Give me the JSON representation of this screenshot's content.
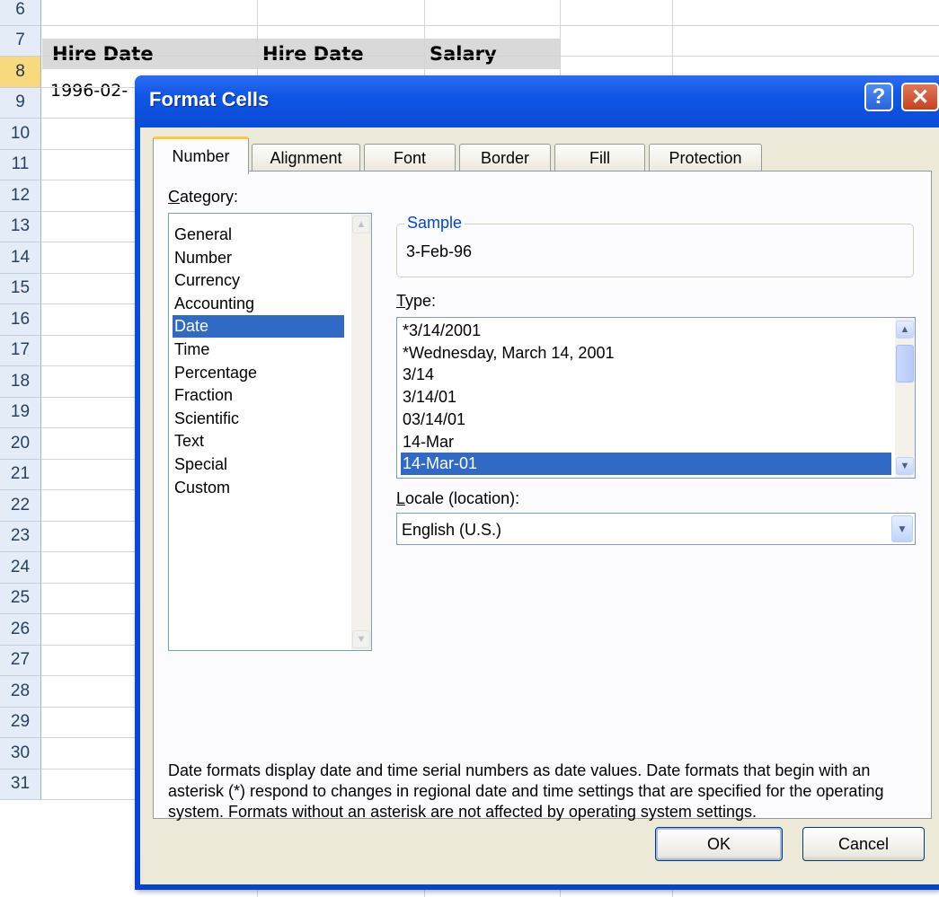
{
  "sheet": {
    "rows": [
      "6",
      "7",
      "8",
      "9",
      "10",
      "11",
      "12",
      "13",
      "14",
      "15",
      "16",
      "17",
      "18",
      "19",
      "20",
      "21",
      "22",
      "23",
      "24",
      "25",
      "26",
      "27",
      "28",
      "29",
      "30",
      "31"
    ],
    "selected_row": "8",
    "headers": [
      "Hire Date",
      "Hire Date",
      "Salary"
    ],
    "cell_a8": "1996-02-"
  },
  "dialog": {
    "title": "Format Cells",
    "help_label": "?",
    "close_label": "✕",
    "tabs": [
      "Number",
      "Alignment",
      "Font",
      "Border",
      "Fill",
      "Protection"
    ],
    "active_tab": "Number",
    "category_label_accel": "C",
    "category_label_rest": "ategory:",
    "categories": [
      "General",
      "Number",
      "Currency",
      "Accounting",
      "Date",
      "Time",
      "Percentage",
      "Fraction",
      "Scientific",
      "Text",
      "Special",
      "Custom"
    ],
    "selected_category": "Date",
    "sample_legend": "Sample",
    "sample_value": "3-Feb-96",
    "type_label_accel": "T",
    "type_label_rest": "ype:",
    "types": [
      "*3/14/2001",
      "*Wednesday, March 14, 2001",
      "3/14",
      "3/14/01",
      "03/14/01",
      "14-Mar",
      "14-Mar-01"
    ],
    "selected_type": "14-Mar-01",
    "locale_label_accel": "L",
    "locale_label_rest": "ocale (location):",
    "locale_value": "English (U.S.)",
    "description": "Date formats display date and time serial numbers as date values.  Date formats that begin with an asterisk (*) respond to changes in regional date and time settings that are specified for the operating system. Formats without an asterisk are not affected by operating system settings.",
    "ok_label": "OK",
    "cancel_label": "Cancel"
  },
  "colors": {
    "title_bar": "#0a4cd6",
    "selection": "#316ac5",
    "active_tab_accent": "#ffc83c",
    "dialog_face": "#ece9d8"
  },
  "icons": {
    "scroll_up": "chevron-up-icon",
    "scroll_down": "chevron-down-icon",
    "combo_drop": "chevron-down-icon"
  }
}
